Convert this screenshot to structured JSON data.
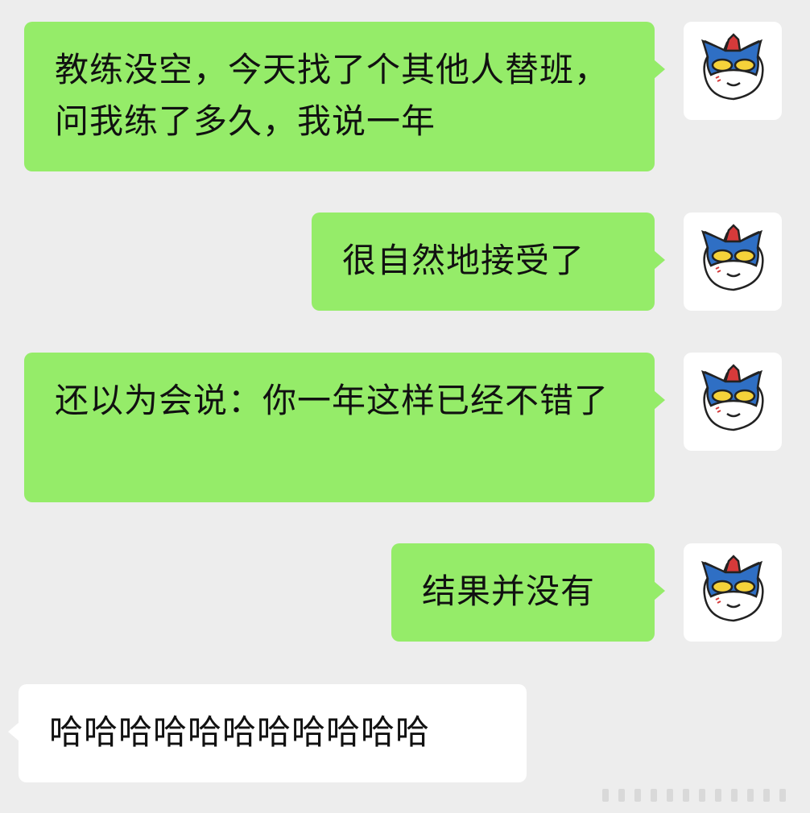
{
  "chat": {
    "messages": [
      {
        "direction": "sent",
        "text": "教练没空，今天找了个其他人替班，问我练了多久，我说一年"
      },
      {
        "direction": "sent",
        "text": "很自然地接受了"
      },
      {
        "direction": "sent",
        "text": "还以为会说：你一年这样已经不错了"
      },
      {
        "direction": "sent",
        "text": "结果并没有"
      },
      {
        "direction": "received",
        "text": "哈哈哈哈哈哈哈哈哈哈哈"
      }
    ]
  },
  "colors": {
    "background": "#ededed",
    "sent_bubble": "#95ec69",
    "received_bubble": "#ffffff"
  },
  "icons": {
    "avatar": "masked-hero-avatar-icon"
  }
}
